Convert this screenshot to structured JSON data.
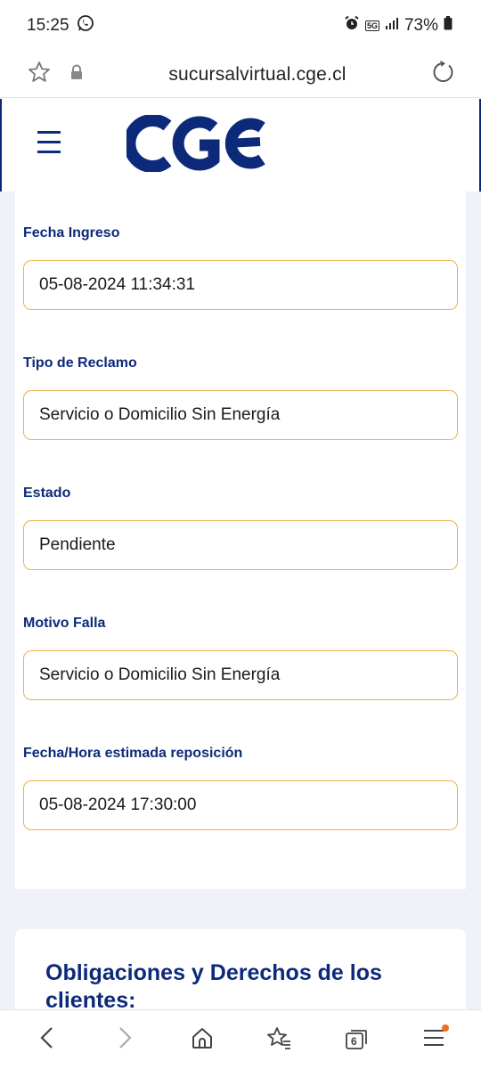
{
  "status_bar": {
    "time": "15:25",
    "battery": "73%",
    "network": "5G"
  },
  "browser": {
    "url": "sucursalvirtual.cge.cl",
    "tab_count": "6"
  },
  "header": {
    "logo_text": "CGE"
  },
  "fields": [
    {
      "label": "Fecha Ingreso",
      "value": "05-08-2024 11:34:31"
    },
    {
      "label": "Tipo de Reclamo",
      "value": "Servicio o Domicilio Sin Energía"
    },
    {
      "label": "Estado",
      "value": "Pendiente"
    },
    {
      "label": "Motivo Falla",
      "value": "Servicio o Domicilio Sin Energía"
    },
    {
      "label": "Fecha/Hora estimada reposición",
      "value": "05-08-2024 17:30:00"
    }
  ],
  "section2": {
    "title": "Obligaciones y Derechos de los clientes:"
  },
  "colors": {
    "brand_blue": "#0d2a7a",
    "field_border": "#e8b24a",
    "page_bg": "#eff2f8",
    "notification_dot": "#f26b22"
  }
}
